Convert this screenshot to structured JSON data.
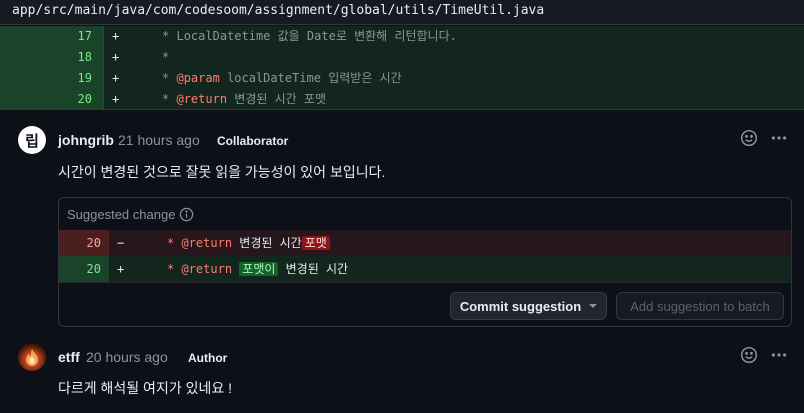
{
  "file": {
    "path": "app/src/main/java/com/codesoom/assignment/global/utils/TimeUtil.java"
  },
  "diff": {
    "lines": [
      {
        "num": "17",
        "sign": "+",
        "star": "*",
        "text": "LocalDatetime 값을 Date로 변환해 리턴합니다."
      },
      {
        "num": "18",
        "sign": "+",
        "star": "*"
      },
      {
        "num": "19",
        "sign": "+",
        "star": "*",
        "tag": "@param",
        "param": "localDateTime",
        "text": "입력받은 시간"
      },
      {
        "num": "20",
        "sign": "+",
        "star": "*",
        "tag": "@return",
        "text": "변경된 시간 포맷"
      }
    ]
  },
  "comments": [
    {
      "avatar_text": "립",
      "author": "johngrib",
      "time": "21 hours ago",
      "badge": "Collaborator",
      "body": "시간이 변경된 것으로 잘못 읽을 가능성이 있어 보입니다.",
      "actions": {
        "reaction_icon": "smiley-icon",
        "menu_icon": "kebab-horizontal-icon"
      },
      "suggestion": {
        "header": "Suggested change",
        "info_icon": "info-icon",
        "removed": {
          "num": "20",
          "sign": "−",
          "star": "*",
          "tag": "@return",
          "text": "변경된 시간",
          "highlight": "포맷"
        },
        "added": {
          "num": "20",
          "sign": "+",
          "star": "*",
          "tag": "@return",
          "highlight": "포맷이",
          "text": "변경된 시간"
        },
        "commit_button": "Commit suggestion",
        "batch_button": "Add suggestion to batch"
      }
    },
    {
      "author": "etff",
      "time": "20 hours ago",
      "badge": "Author",
      "body": "다르게 해석될 여지가 있네요 !",
      "actions": {
        "reaction_icon": "smiley-icon",
        "menu_icon": "kebab-horizontal-icon"
      }
    }
  ],
  "colors": {
    "background": "#0d1117",
    "addition_bg": "#12261e",
    "addition_gutter": "#1a4429",
    "deletion_bg": "#25171c",
    "deletion_gutter": "#4b1f1f",
    "keyword": "#ff7b72",
    "muted": "#8b949e"
  }
}
